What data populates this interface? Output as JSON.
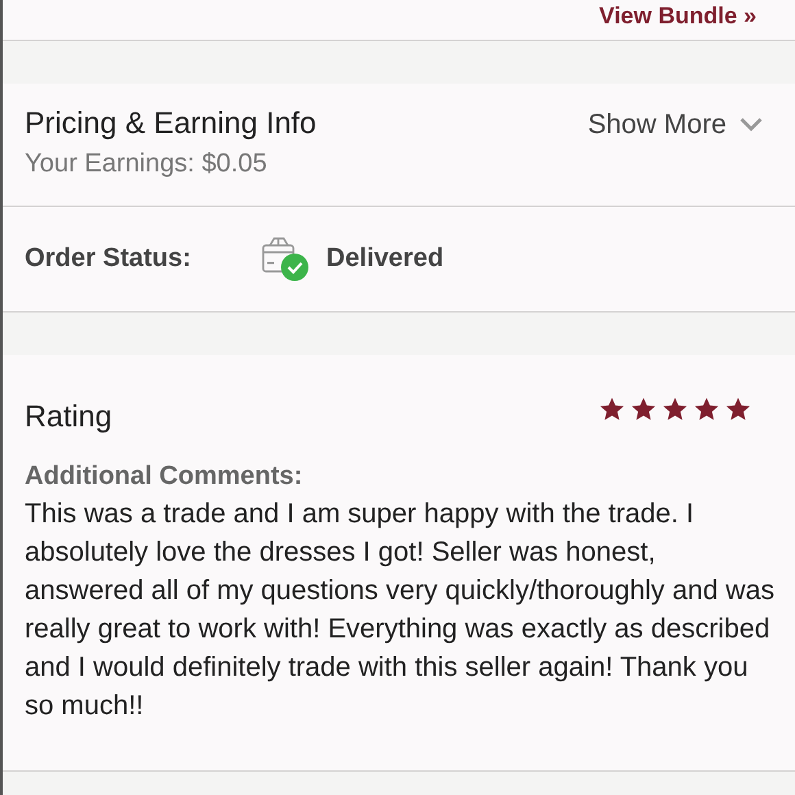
{
  "bundle_link": "View Bundle »",
  "pricing": {
    "title": "Pricing & Earning Info",
    "earnings": "Your Earnings: $0.05",
    "toggle": "Show More",
    "expanded": false
  },
  "order_status": {
    "label": "Order Status:",
    "status": "Delivered"
  },
  "rating": {
    "title": "Rating",
    "stars": 5,
    "comments_label": "Additional Comments:",
    "comment": "This was a trade and I am super happy with the trade. I absolutely love the dresses I got! Seller was honest, answered all of my questions very quickly/thoroughly and was really great to work with! Everything was exactly as described and I would definitely trade with this seller again! Thank you so much!!"
  }
}
